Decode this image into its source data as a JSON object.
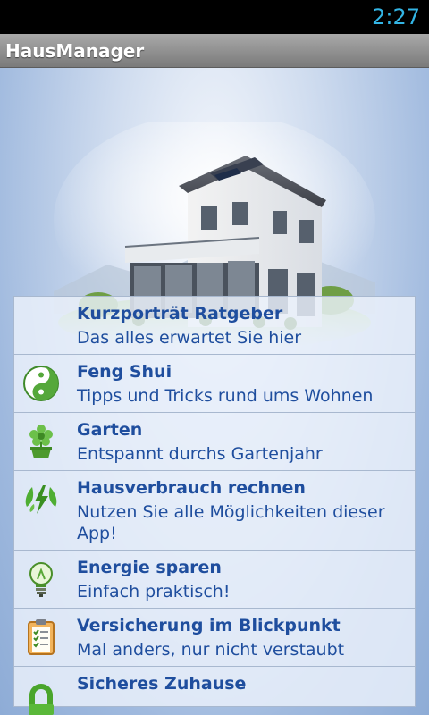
{
  "status_bar": {
    "time": "2:27"
  },
  "app": {
    "title": "HausManager"
  },
  "menu": {
    "items": [
      {
        "title": "Kurzporträt Ratgeber",
        "subtitle": "Das alles erwartet Sie hier",
        "icon": "none"
      },
      {
        "title": "Feng Shui",
        "subtitle": "Tipps und Tricks rund ums Wohnen",
        "icon": "yin-yang-icon"
      },
      {
        "title": "Garten",
        "subtitle": "Entspannt durchs Gartenjahr",
        "icon": "flower-pot-icon"
      },
      {
        "title": "Hausverbrauch rechnen",
        "subtitle": "Nutzen Sie alle Möglichkeiten dieser App!",
        "icon": "energy-leaves-icon"
      },
      {
        "title": "Energie sparen",
        "subtitle": "Einfach praktisch!",
        "icon": "light-bulb-icon"
      },
      {
        "title": "Versicherung im Blickpunkt",
        "subtitle": "Mal anders, nur nicht verstaubt",
        "icon": "clipboard-checklist-icon"
      },
      {
        "title": "Sicheres Zuhause",
        "subtitle": "",
        "icon": "padlock-icon"
      }
    ]
  },
  "colors": {
    "accent": "#33b5e5",
    "item_text": "#1f4e9e",
    "background": "#9fb9de"
  }
}
